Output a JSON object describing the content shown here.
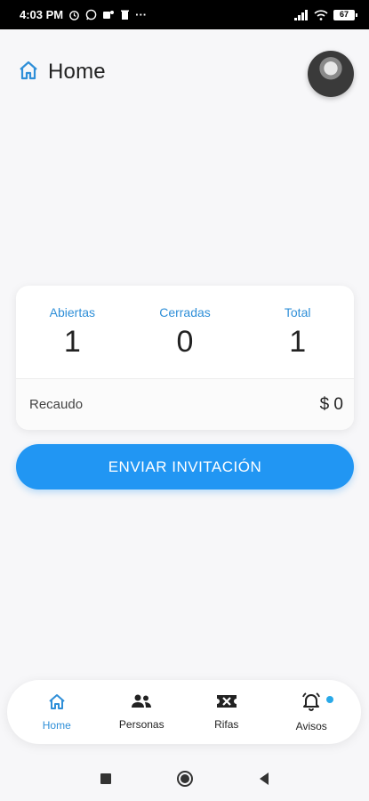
{
  "status_bar": {
    "time": "4:03 PM",
    "battery": "67",
    "more": "···"
  },
  "app_bar": {
    "title": "Home",
    "icon": "home-outline-icon"
  },
  "stats": {
    "items": [
      {
        "label": "Abiertas",
        "value": "1"
      },
      {
        "label": "Cerradas",
        "value": "0"
      },
      {
        "label": "Total",
        "value": "1"
      }
    ],
    "recaudo_label": "Recaudo",
    "recaudo_value": "$ 0"
  },
  "invite_button": {
    "label": "ENVIAR INVITACIÓN"
  },
  "bottom_nav": {
    "items": [
      {
        "label": "Home",
        "icon": "home-icon",
        "active": true
      },
      {
        "label": "Personas",
        "icon": "people-icon"
      },
      {
        "label": "Rifas",
        "icon": "ticket-icon"
      },
      {
        "label": "Avisos",
        "icon": "bell-icon",
        "badge": true
      }
    ]
  },
  "colors": {
    "accent": "#2196f3",
    "label_blue": "#2f8fd8",
    "badge": "#29a9e8"
  }
}
